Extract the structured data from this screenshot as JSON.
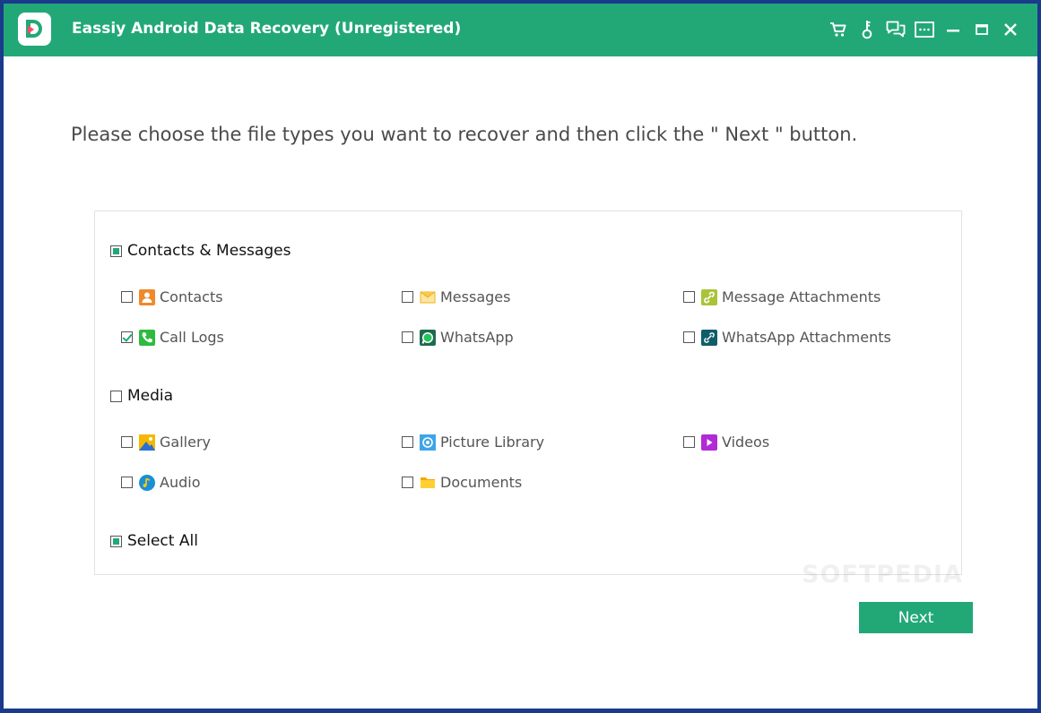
{
  "titlebar": {
    "title": "Eassiy Android Data Recovery (Unregistered)",
    "icons": [
      "cart-icon",
      "key-icon",
      "feedback-icon",
      "menu-icon",
      "minimize-icon",
      "maximize-icon",
      "close-icon"
    ]
  },
  "instruction": "Please choose the file types you want to recover and then click the \" Next \" button.",
  "groups": {
    "contacts_messages": {
      "label": "Contacts & Messages",
      "state": "partial",
      "items": {
        "contacts": {
          "label": "Contacts",
          "checked": false,
          "icon": "contacts-icon"
        },
        "messages": {
          "label": "Messages",
          "checked": false,
          "icon": "messages-icon"
        },
        "message_attachments": {
          "label": "Message Attachments",
          "checked": false,
          "icon": "attachment-icon"
        },
        "call_logs": {
          "label": "Call Logs",
          "checked": true,
          "icon": "phone-icon"
        },
        "whatsapp": {
          "label": "WhatsApp",
          "checked": false,
          "icon": "whatsapp-icon"
        },
        "whatsapp_attachments": {
          "label": "WhatsApp Attachments",
          "checked": false,
          "icon": "whatsapp-attachment-icon"
        }
      }
    },
    "media": {
      "label": "Media",
      "state": "unchecked",
      "items": {
        "gallery": {
          "label": "Gallery",
          "checked": false,
          "icon": "gallery-icon"
        },
        "picture_library": {
          "label": "Picture Library",
          "checked": false,
          "icon": "picture-library-icon"
        },
        "videos": {
          "label": "Videos",
          "checked": false,
          "icon": "video-icon"
        },
        "audio": {
          "label": "Audio",
          "checked": false,
          "icon": "audio-icon"
        },
        "documents": {
          "label": "Documents",
          "checked": false,
          "icon": "folder-icon"
        }
      }
    },
    "select_all": {
      "label": "Select All",
      "state": "partial"
    }
  },
  "next_button": {
    "label": "Next"
  },
  "watermark": "SOFTPEDIA",
  "colors": {
    "accent": "#22a877",
    "frame": "#1a3a8c"
  }
}
